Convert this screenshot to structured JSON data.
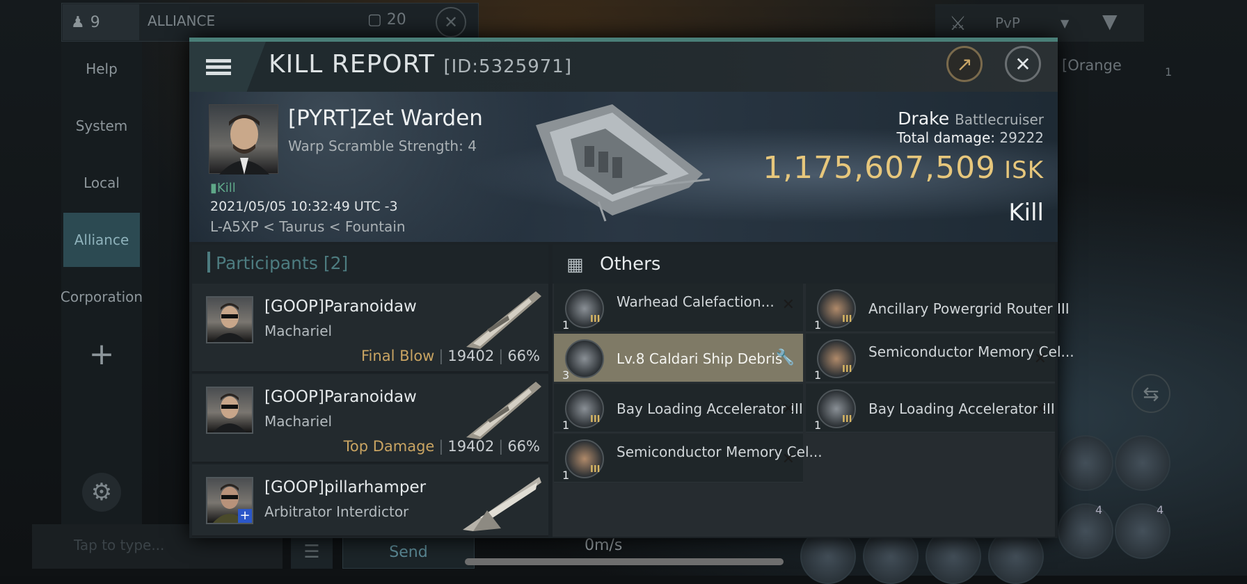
{
  "background": {
    "member_count": "9",
    "channel": "ALLIANCE",
    "chat_count": "20",
    "sidebar": [
      "Help",
      "System",
      "Local",
      "Alliance",
      "Corporation"
    ],
    "filter": "PvP",
    "chat_placeholder": "Tap to type...",
    "send_label": "Send",
    "speed": "0m/s",
    "right_preview": "[Orange",
    "right_count": "1",
    "module_counts": [
      "4",
      "4"
    ]
  },
  "report": {
    "title": "KILL REPORT",
    "id": "[ID:5325971]",
    "victim": {
      "name": "[PYRT]Zet Warden",
      "scramble": "Warp Scramble Strength: 4",
      "kill_tag": "Kill",
      "datetime": "2021/05/05 10:32:49 UTC -3",
      "location": "L-A5XP < Taurus < Fountain"
    },
    "ship": {
      "name": "Drake",
      "class": "Battlecruiser",
      "total_damage_label": "Total damage:",
      "total_damage": "29222",
      "isk_value": "1,175,607,509",
      "isk_unit": "ISK",
      "result": "Kill"
    },
    "participants": {
      "label": "Participants",
      "count": "[2]",
      "rows": [
        {
          "name": "[GOOP]Paranoidaw",
          "ship": "Machariel",
          "tag": "Final Blow",
          "damage": "19402",
          "percent": "66%"
        },
        {
          "name": "[GOOP]Paranoidaw",
          "ship": "Machariel",
          "tag": "Top Damage",
          "damage": "19402",
          "percent": "66%"
        },
        {
          "name": "[GOOP]pillarhamper",
          "ship": "Arbitrator Interdictor",
          "tag": "",
          "damage": "",
          "percent": ""
        }
      ]
    },
    "others": {
      "label": "Others",
      "items": [
        {
          "name": "Warhead Calefaction...",
          "qty": "1"
        },
        {
          "name": "Ancillary Powergrid Router III",
          "qty": "1"
        },
        {
          "name": "Lv.8 Caldari Ship Debris",
          "qty": "3"
        },
        {
          "name": "Semiconductor Memory Cel...",
          "qty": "1"
        },
        {
          "name": "Bay Loading Accelerator III",
          "qty": "1"
        },
        {
          "name": "Bay Loading Accelerator III",
          "qty": "1"
        },
        {
          "name": "Semiconductor Memory Cel...",
          "qty": "1"
        }
      ]
    }
  },
  "colors": {
    "accent": "#4a7f78",
    "isk": "#e7c77c",
    "tag": "#c9a462",
    "kill": "#5fa889"
  }
}
